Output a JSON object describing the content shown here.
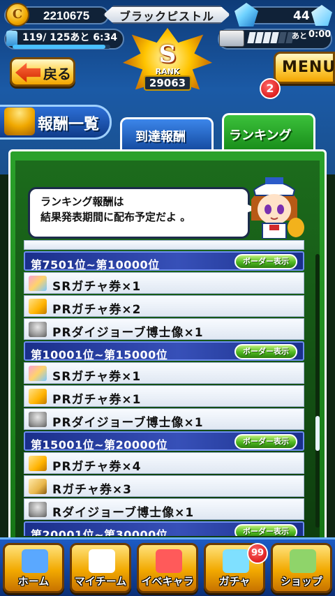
{
  "header": {
    "coins": "2210675",
    "player_name": "ブラックピストル",
    "gems": "44",
    "stamina": {
      "text": "119/ 125あと 6:34",
      "fraction": 0.952
    },
    "tickets": {
      "filled": 4,
      "total": 6,
      "ato": "あと",
      "time": "0:00"
    },
    "rank": {
      "letter": "S",
      "label": "RANK",
      "value": "29063"
    },
    "back_label": "戻る",
    "menu_label": "MENU",
    "menu_badge": "2"
  },
  "reward_list_label": "報酬一覧",
  "tabs": [
    {
      "label": "到達報酬",
      "active": false
    },
    {
      "label": "ランキング",
      "active": true
    }
  ],
  "speech": {
    "line1": "ランキング報酬は",
    "line2": "結果発表期間に配布予定だよ 。"
  },
  "border_label": "ボーダー表示",
  "ranges": [
    {
      "title": "第7501位~第10000位",
      "items": [
        {
          "icon": "sr",
          "label": "SRガチャ券×1"
        },
        {
          "icon": "pr",
          "label": "PRガチャ券×2"
        },
        {
          "icon": "statue",
          "label": "PRダイジョーブ博士像×1"
        }
      ]
    },
    {
      "title": "第10001位~第15000位",
      "items": [
        {
          "icon": "sr",
          "label": "SRガチャ券×1"
        },
        {
          "icon": "pr",
          "label": "PRガチャ券×1"
        },
        {
          "icon": "statue",
          "label": "PRダイジョーブ博士像×1"
        }
      ]
    },
    {
      "title": "第15001位~第20000位",
      "items": [
        {
          "icon": "pr",
          "label": "PRガチャ券×4"
        },
        {
          "icon": "r",
          "label": "Rガチャ券×3"
        },
        {
          "icon": "statue",
          "label": "Rダイジョーブ博士像×1"
        }
      ]
    },
    {
      "title": "第20001位~第30000位",
      "items": []
    }
  ],
  "nav": [
    {
      "label": "ホーム",
      "icon": "home-icon"
    },
    {
      "label": "マイチーム",
      "icon": "team-icon"
    },
    {
      "label": "イベキャラ",
      "icon": "event-chara-icon"
    },
    {
      "label": "ガチャ",
      "icon": "gacha-icon"
    },
    {
      "label": "ショップ",
      "icon": "shop-icon"
    }
  ],
  "gacha_badge": "99",
  "colors": {
    "accent_green": "#2aa12a",
    "accent_blue": "#1a2f8a",
    "button_gold": "#f2a900"
  }
}
